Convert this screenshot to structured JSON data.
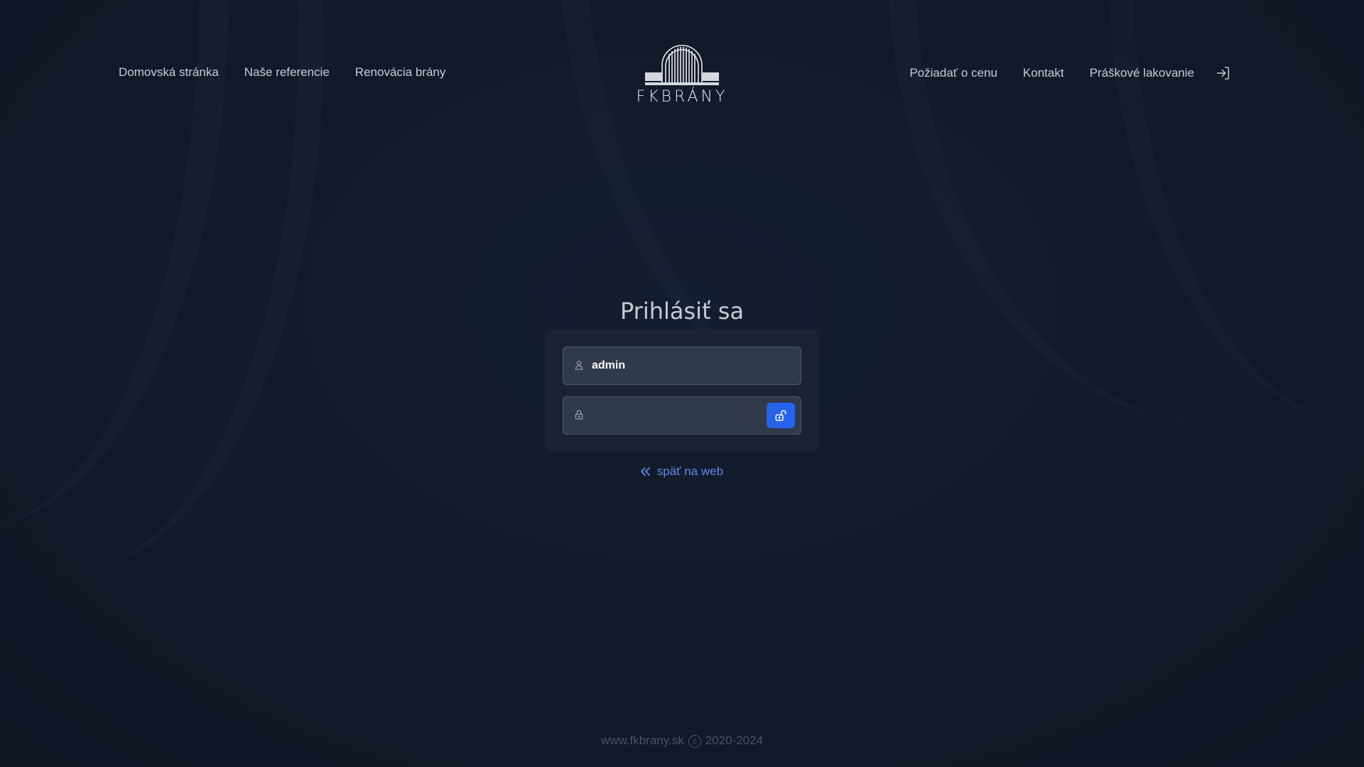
{
  "header": {
    "nav_left": [
      {
        "label": "Domovská stránka"
      },
      {
        "label": "Naše referencie"
      },
      {
        "label": "Renovácia brány"
      }
    ],
    "logo_text": "FKBRÁNY",
    "nav_right": [
      {
        "label": "Požiadať o cenu"
      },
      {
        "label": "Kontakt"
      },
      {
        "label": "Práškové lakovanie"
      }
    ],
    "login_icon": "login-arrow-icon"
  },
  "login": {
    "title": "Prihlásiť sa",
    "username_value": "admin",
    "username_icon": "user-icon",
    "password_value": "",
    "password_icon": "lock-icon",
    "submit_icon": "unlock-icon",
    "back_link": "späť na web"
  },
  "footer": {
    "site": "www.fkbrany.sk",
    "years": "2020-2024"
  },
  "colors": {
    "background": "#121a2a",
    "card": "#1a2233",
    "input": "#313a4b",
    "accent": "#2563eb",
    "link": "#5b8de8"
  }
}
